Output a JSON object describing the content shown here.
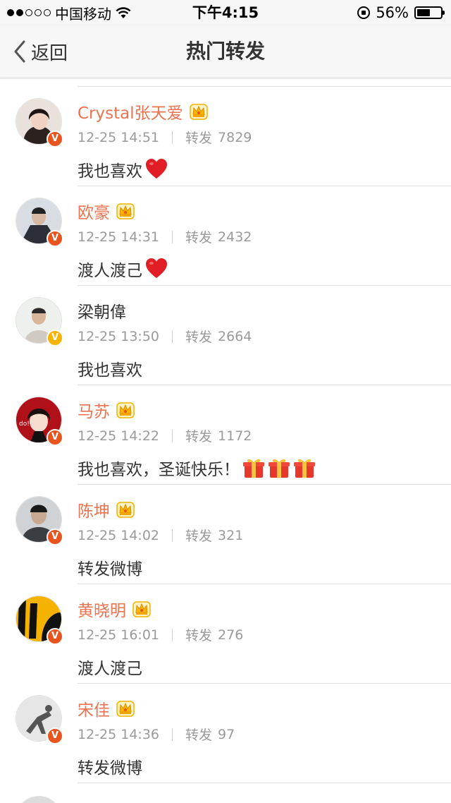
{
  "status_bar": {
    "carrier": "中国移动",
    "time": "下午4:15",
    "battery_percent": "56%",
    "battery_level": 0.56,
    "signal_bars_filled": 2,
    "signal_bars_total": 5
  },
  "nav": {
    "back_label": "返回",
    "title": "热门转发"
  },
  "colors": {
    "vip_name": "#eb7350",
    "normal_name": "#333333",
    "badge_orange": "#e8541e",
    "badge_yellow": "#f5b400",
    "meta_gray": "#9a9a9a"
  },
  "reposts": [
    {
      "name": "Crystal张天爱",
      "vip": true,
      "badge": "orange",
      "time": "12-25 14:51",
      "repost_label": "转发",
      "repost_count": "7829",
      "text": "我也喜欢",
      "emojis": [
        "heart-icon"
      ]
    },
    {
      "name": "欧豪",
      "vip": true,
      "badge": "orange",
      "time": "12-25 14:31",
      "repost_label": "转发",
      "repost_count": "2432",
      "text": "渡人渡己",
      "emojis": [
        "heart-icon"
      ]
    },
    {
      "name": "梁朝偉",
      "vip": false,
      "badge": "yellow",
      "time": "12-25 13:50",
      "repost_label": "转发",
      "repost_count": "2664",
      "text": "我也喜欢",
      "emojis": []
    },
    {
      "name": "马苏",
      "vip": true,
      "badge": "orange",
      "time": "12-25 14:22",
      "repost_label": "转发",
      "repost_count": "1172",
      "text": "我也喜欢，圣诞快乐！",
      "emojis": [
        "gift-icon",
        "gift-icon",
        "gift-icon"
      ]
    },
    {
      "name": "陈坤",
      "vip": true,
      "badge": "orange",
      "time": "12-25 14:02",
      "repost_label": "转发",
      "repost_count": "321",
      "text": "转发微博",
      "emojis": []
    },
    {
      "name": "黄晓明",
      "vip": true,
      "badge": "orange",
      "time": "12-25 16:01",
      "repost_label": "转发",
      "repost_count": "276",
      "text": "渡人渡己",
      "emojis": []
    },
    {
      "name": "宋佳",
      "vip": true,
      "badge": "orange",
      "time": "12-25 14:36",
      "repost_label": "转发",
      "repost_count": "97",
      "text": "转发微博",
      "emojis": []
    }
  ]
}
